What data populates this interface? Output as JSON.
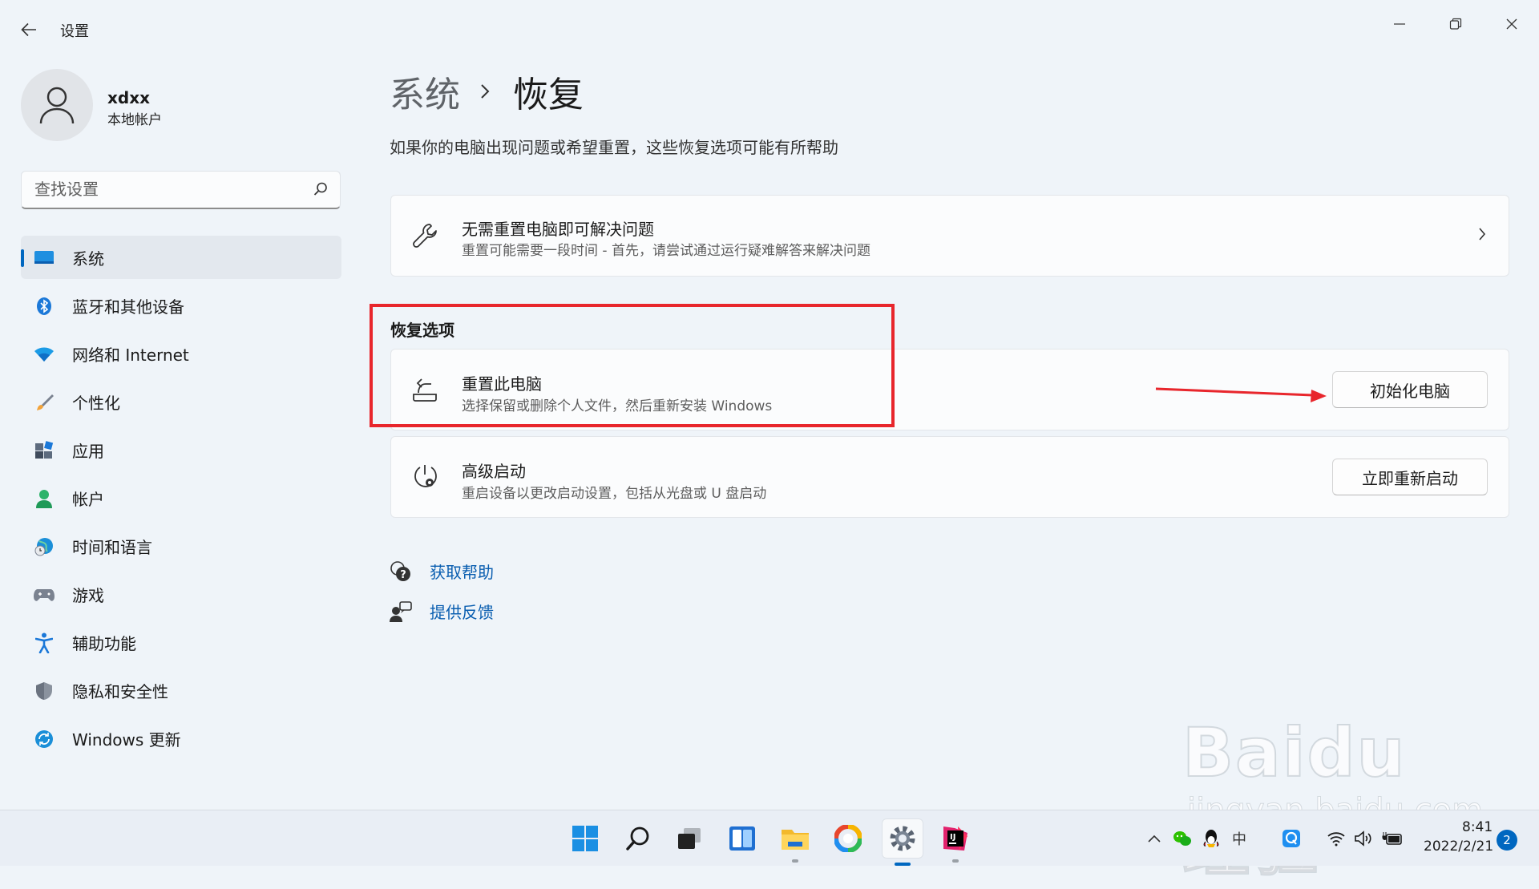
{
  "window": {
    "title": "设置"
  },
  "user": {
    "name": "xdxx",
    "account_type": "本地帐户"
  },
  "search": {
    "placeholder": "查找设置"
  },
  "sidebar": {
    "items": [
      {
        "label": "系统",
        "icon": "system-display-icon",
        "active": true
      },
      {
        "label": "蓝牙和其他设备",
        "icon": "bluetooth-icon"
      },
      {
        "label": "网络和 Internet",
        "icon": "wifi-icon"
      },
      {
        "label": "个性化",
        "icon": "brush-icon"
      },
      {
        "label": "应用",
        "icon": "apps-icon"
      },
      {
        "label": "帐户",
        "icon": "account-icon"
      },
      {
        "label": "时间和语言",
        "icon": "globe-clock-icon"
      },
      {
        "label": "游戏",
        "icon": "gamepad-icon"
      },
      {
        "label": "辅助功能",
        "icon": "accessibility-icon"
      },
      {
        "label": "隐私和安全性",
        "icon": "shield-icon"
      },
      {
        "label": "Windows 更新",
        "icon": "update-icon"
      }
    ]
  },
  "breadcrumb": {
    "parent": "系统",
    "current": "恢复"
  },
  "page": {
    "subtitle": "如果你的电脑出现问题或希望重置，这些恢复选项可能有所帮助"
  },
  "fix_card": {
    "title": "无需重置电脑即可解决问题",
    "description": "重置可能需要一段时间 - 首先，请尝试通过运行疑难解答来解决问题"
  },
  "recovery_section": {
    "label": "恢复选项",
    "reset": {
      "title": "重置此电脑",
      "description": "选择保留或删除个人文件，然后重新安装 Windows",
      "button": "初始化电脑"
    },
    "advanced": {
      "title": "高级启动",
      "description": "重启设备以更改启动设置，包括从光盘或 U 盘启动",
      "button": "立即重新启动"
    }
  },
  "links": {
    "help": "获取帮助",
    "feedback": "提供反馈"
  },
  "watermark": {
    "brand": "Baidu经验",
    "url": "jingyan.baidu.com"
  },
  "taskbar": {
    "ime": "中",
    "time": "8:41",
    "date": "2022/2/21",
    "notifications": "2"
  },
  "colors": {
    "accent": "#0067c0",
    "highlight": "#e8262c",
    "link": "#0a5eb0"
  }
}
